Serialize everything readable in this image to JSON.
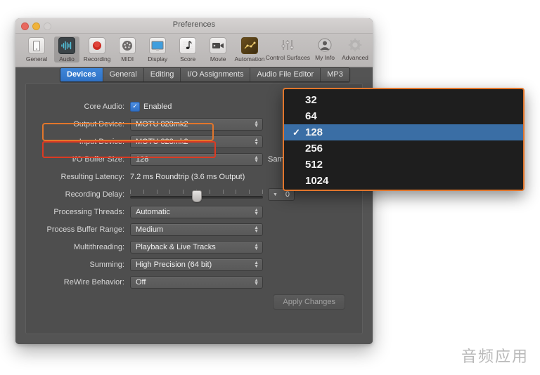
{
  "window": {
    "title": "Preferences",
    "traffic_lights": [
      "close",
      "minimize",
      "zoom"
    ]
  },
  "toolbar": {
    "items": [
      {
        "label": "General",
        "icon": "general-icon",
        "selected": false
      },
      {
        "label": "Audio",
        "icon": "audio-waveform-icon",
        "selected": true
      },
      {
        "label": "Recording",
        "icon": "record-dot-icon",
        "selected": false
      },
      {
        "label": "MIDI",
        "icon": "midi-port-icon",
        "selected": false
      },
      {
        "label": "Display",
        "icon": "monitor-icon",
        "selected": false
      },
      {
        "label": "Score",
        "icon": "music-note-icon",
        "selected": false
      },
      {
        "label": "Movie",
        "icon": "video-camera-icon",
        "selected": false
      },
      {
        "label": "Automation",
        "icon": "automation-curve-icon",
        "selected": false
      },
      {
        "label": "Control Surfaces",
        "icon": "faders-icon",
        "selected": false
      },
      {
        "label": "My Info",
        "icon": "person-icon",
        "selected": false
      },
      {
        "label": "Advanced",
        "icon": "gear-icon",
        "selected": false
      }
    ]
  },
  "tabs": [
    {
      "label": "Devices",
      "active": true
    },
    {
      "label": "General",
      "active": false
    },
    {
      "label": "Editing",
      "active": false
    },
    {
      "label": "I/O Assignments",
      "active": false
    },
    {
      "label": "Audio File Editor",
      "active": false
    },
    {
      "label": "MP3",
      "active": false
    }
  ],
  "form": {
    "core_audio": {
      "label": "Core Audio:",
      "checkbox_label": "Enabled",
      "checked": true
    },
    "output_device": {
      "label": "Output Device:",
      "value": "MOTU 828mk2"
    },
    "input_device": {
      "label": "Input Device:",
      "value": "MOTU 828mk2"
    },
    "io_buffer_size": {
      "label": "I/O Buffer Size:",
      "value": "128",
      "units": "Samples"
    },
    "resulting_latency": {
      "label": "Resulting Latency:",
      "value": "7.2 ms Roundtrip (3.6 ms Output)"
    },
    "recording_delay": {
      "label": "Recording Delay:",
      "value": "0",
      "slider_position_pct": 50,
      "tick_count": 11
    },
    "processing_threads": {
      "label": "Processing Threads:",
      "value": "Automatic"
    },
    "process_buffer_range": {
      "label": "Process Buffer Range:",
      "value": "Medium"
    },
    "multithreading": {
      "label": "Multithreading:",
      "value": "Playback & Live Tracks"
    },
    "summing": {
      "label": "Summing:",
      "value": "High Precision (64 bit)"
    },
    "rewire_behavior": {
      "label": "ReWire Behavior:",
      "value": "Off"
    },
    "apply_button": "Apply Changes"
  },
  "buffer_menu": {
    "options": [
      {
        "label": "32",
        "checked": false,
        "highlighted": false
      },
      {
        "label": "64",
        "checked": false,
        "highlighted": false
      },
      {
        "label": "128",
        "checked": true,
        "highlighted": true
      },
      {
        "label": "256",
        "checked": false,
        "highlighted": false
      },
      {
        "label": "512",
        "checked": false,
        "highlighted": false
      },
      {
        "label": "1024",
        "checked": false,
        "highlighted": false
      }
    ],
    "checkmark": "✓"
  },
  "annotations": {
    "orange_highlight_target": "I/O Buffer Size row",
    "red_highlight_target": "Resulting Latency row",
    "orange_color": "#e2762c",
    "red_color": "#dc3a22"
  },
  "watermark": "音频应用"
}
